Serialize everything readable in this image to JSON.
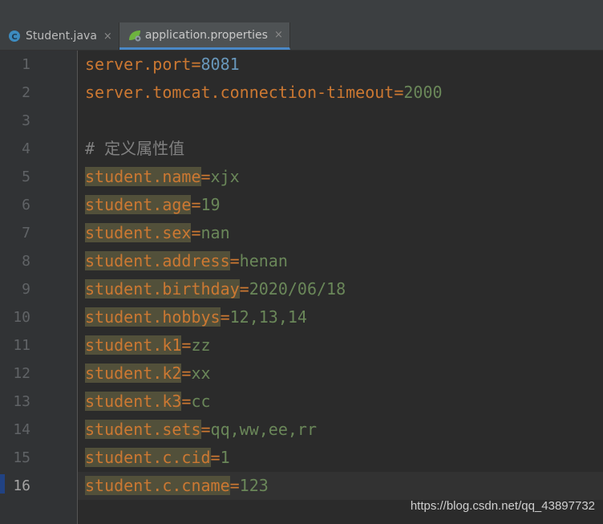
{
  "tabs": [
    {
      "label": "Student.java",
      "icon": "java-class-icon",
      "active": false
    },
    {
      "label": "application.properties",
      "icon": "spring-leaf-icon",
      "active": true
    }
  ],
  "close_glyph": "×",
  "line_numbers": [
    "1",
    "2",
    "3",
    "4",
    "5",
    "6",
    "7",
    "8",
    "9",
    "10",
    "11",
    "12",
    "13",
    "14",
    "15",
    "16"
  ],
  "code": {
    "l1": {
      "key": "server.port",
      "eq": "=",
      "value": "8081"
    },
    "l2": {
      "key": "server.tomcat.connection-timeout",
      "eq": "=",
      "value": "2000"
    },
    "l4": {
      "comment": "# 定义属性值"
    },
    "l5": {
      "key": "student.name",
      "eq": "=",
      "value": "xjx"
    },
    "l6": {
      "key": "student.age",
      "eq": "=",
      "value": "19"
    },
    "l7": {
      "key": "student.sex",
      "eq": "=",
      "value": "nan"
    },
    "l8": {
      "key": "student.address",
      "eq": "=",
      "value": "henan"
    },
    "l9": {
      "key": "student.birthday",
      "eq": "=",
      "value": "2020/06/18"
    },
    "l10": {
      "key": "student.hobbys",
      "eq": "=",
      "value": "12,13,14"
    },
    "l11": {
      "key": "student.k1",
      "eq": "=",
      "value": "zz"
    },
    "l12": {
      "key": "student.k2",
      "eq": "=",
      "value": "xx"
    },
    "l13": {
      "key": "student.k3",
      "eq": "=",
      "value": "cc"
    },
    "l14": {
      "key": "student.sets",
      "eq": "=",
      "value": "qq,ww,ee,rr"
    },
    "l15": {
      "key": "student.c.cid",
      "eq": "=",
      "value": "1"
    },
    "l16": {
      "key": "student.c.cname",
      "eq": "=",
      "value": "123"
    }
  },
  "current_line": "16",
  "watermark": "https://blog.csdn.net/qq_43897732",
  "colors": {
    "key": "#cc7832",
    "value": "#6a8759",
    "number": "#6897bb",
    "comment": "#808080",
    "highlight": "#52503a",
    "tab_accent": "#4a88c7",
    "background": "#2b2b2b"
  }
}
